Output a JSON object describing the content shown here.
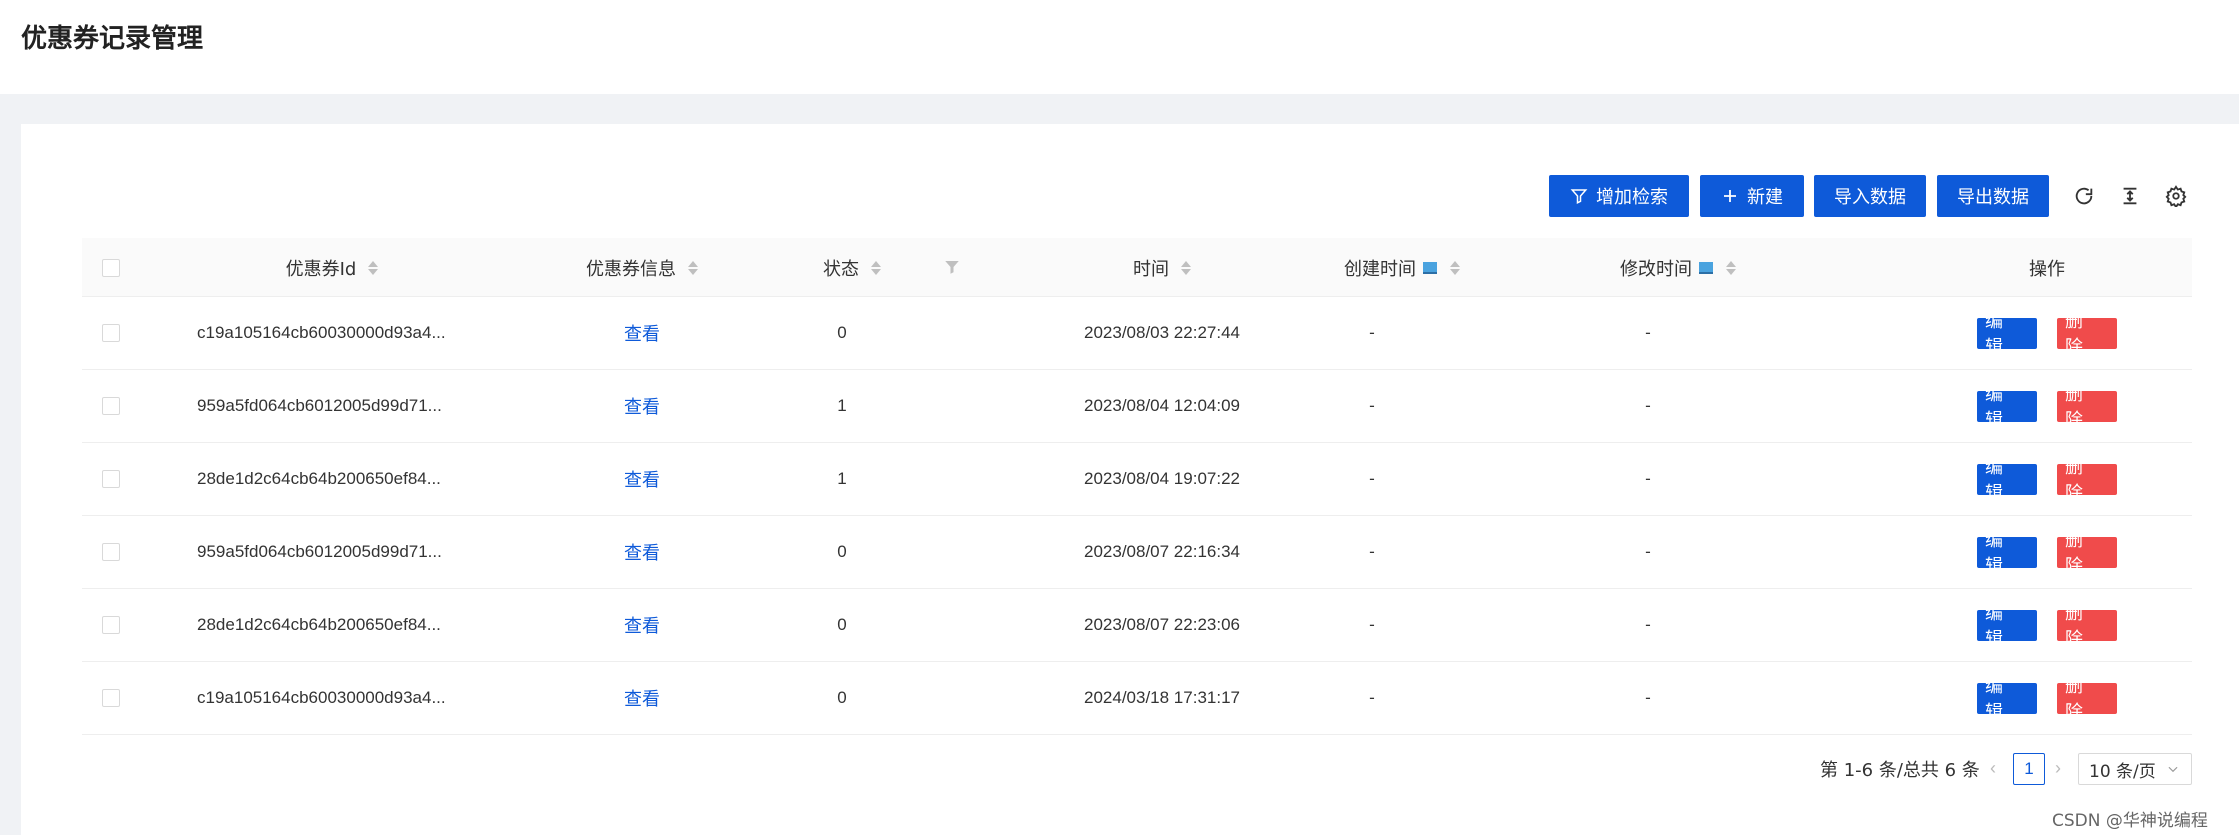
{
  "page": {
    "title": "优惠券记录管理"
  },
  "toolbar": {
    "add_search": "增加检索",
    "new": "新建",
    "import": "导入数据",
    "export": "导出数据"
  },
  "table": {
    "columns": {
      "id": "优惠券Id",
      "info": "优惠券信息",
      "status": "状态",
      "time": "时间",
      "created": "创建时间",
      "modified": "修改时间",
      "actions": "操作"
    },
    "rows": [
      {
        "id": "c19a105164cb60030000d93a4...",
        "info": "查看",
        "status": "0",
        "time": "2023/08/03 22:27:44",
        "created": "-",
        "modified": "-"
      },
      {
        "id": "959a5fd064cb6012005d99d71...",
        "info": "查看",
        "status": "1",
        "time": "2023/08/04 12:04:09",
        "created": "-",
        "modified": "-"
      },
      {
        "id": "28de1d2c64cb64b200650ef84...",
        "info": "查看",
        "status": "1",
        "time": "2023/08/04 19:07:22",
        "created": "-",
        "modified": "-"
      },
      {
        "id": "959a5fd064cb6012005d99d71...",
        "info": "查看",
        "status": "0",
        "time": "2023/08/07 22:16:34",
        "created": "-",
        "modified": "-"
      },
      {
        "id": "28de1d2c64cb64b200650ef84...",
        "info": "查看",
        "status": "0",
        "time": "2023/08/07 22:23:06",
        "created": "-",
        "modified": "-"
      },
      {
        "id": "c19a105164cb60030000d93a4...",
        "info": "查看",
        "status": "0",
        "time": "2024/03/18 17:31:17",
        "created": "-",
        "modified": "-"
      }
    ],
    "edit_label": "编 辑",
    "delete_label": "删 除"
  },
  "pagination": {
    "total_text": "第 1-6 条/总共 6 条",
    "current_page": "1",
    "page_size": "10 条/页"
  },
  "watermark": "CSDN @华神说编程",
  "colors": {
    "primary": "#0e5ad9",
    "danger": "#f04b4b",
    "background": "#f0f2f5"
  }
}
